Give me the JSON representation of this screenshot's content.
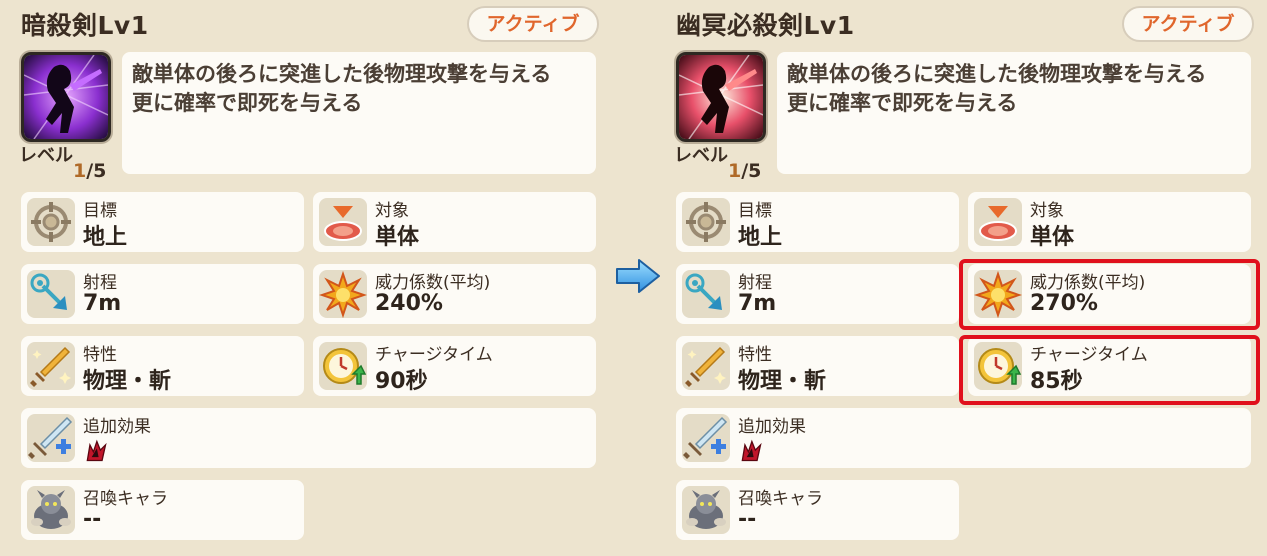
{
  "left": {
    "title": "暗殺剣Lv1",
    "badge": "アクティブ",
    "level_label": "レベル",
    "level_current": "1",
    "level_max": "/5",
    "description": [
      "敵単体の後ろに突進した後物理攻撃を与える",
      "更に確率で即死を与える"
    ],
    "stats": {
      "target": {
        "label": "目標",
        "value": "地上"
      },
      "object": {
        "label": "対象",
        "value": "単体"
      },
      "range": {
        "label": "射程",
        "value": "7m"
      },
      "power": {
        "label": "威力係数(平均)",
        "value": "240%"
      },
      "trait": {
        "label": "特性",
        "value": "物理・斬"
      },
      "charge": {
        "label": "チャージタイム",
        "value": "90秒"
      },
      "extra": {
        "label": "追加効果"
      },
      "summon": {
        "label": "召喚キャラ",
        "value": "--"
      }
    }
  },
  "right": {
    "title": "幽冥必殺剣Lv1",
    "badge": "アクティブ",
    "level_label": "レベル",
    "level_current": "1",
    "level_max": "/5",
    "description": [
      "敵単体の後ろに突進した後物理攻撃を与える",
      "更に確率で即死を与える"
    ],
    "stats": {
      "target": {
        "label": "目標",
        "value": "地上"
      },
      "object": {
        "label": "対象",
        "value": "単体"
      },
      "range": {
        "label": "射程",
        "value": "7m"
      },
      "power": {
        "label": "威力係数(平均)",
        "value": "270%"
      },
      "trait": {
        "label": "特性",
        "value": "物理・斬"
      },
      "charge": {
        "label": "チャージタイム",
        "value": "85秒"
      },
      "extra": {
        "label": "追加効果"
      },
      "summon": {
        "label": "召喚キャラ",
        "value": "--"
      }
    }
  },
  "colors": {
    "badge_text": "#e0662c",
    "highlight": "#e0101c",
    "level_current": "#b06a28"
  },
  "icons": {
    "target": "crosshair-icon",
    "object": "target-area-icon",
    "range": "range-arrow-icon",
    "power": "explosion-icon",
    "trait": "sword-icon",
    "charge": "clock-up-icon",
    "extra": "sword-plus-icon",
    "summon": "summon-creature-icon",
    "arrow": "right-arrow-icon"
  }
}
